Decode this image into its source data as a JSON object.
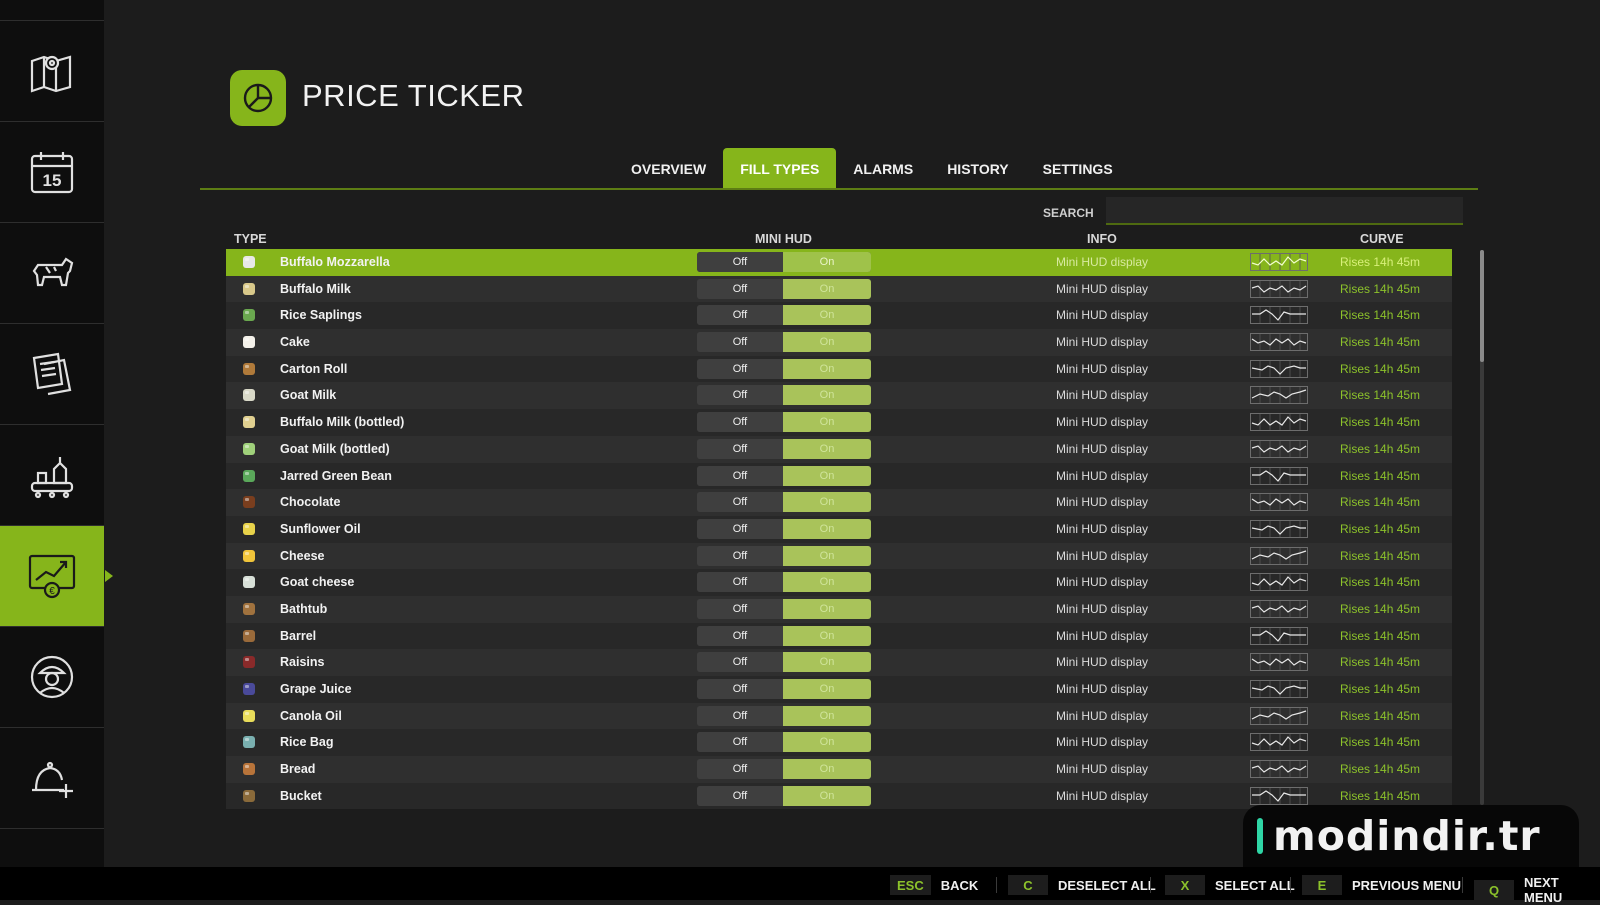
{
  "sidebar": {
    "items": [
      {
        "icon": "map-icon"
      },
      {
        "icon": "calendar-icon",
        "text": "15"
      },
      {
        "icon": "cow-icon"
      },
      {
        "icon": "documents-icon"
      },
      {
        "icon": "production-icon"
      },
      {
        "icon": "price-chart-icon",
        "active": true
      },
      {
        "icon": "worker-icon"
      },
      {
        "icon": "cloche-plus-icon"
      }
    ]
  },
  "header": {
    "title": "PRICE TICKER",
    "icon": "pie-chart-icon"
  },
  "tabs": [
    {
      "label": "OVERVIEW"
    },
    {
      "label": "FILL TYPES",
      "active": true
    },
    {
      "label": "ALARMS"
    },
    {
      "label": "HISTORY"
    },
    {
      "label": "SETTINGS"
    }
  ],
  "search": {
    "label": "SEARCH",
    "value": ""
  },
  "columns": {
    "type": "TYPE",
    "minihud": "MINI HUD",
    "info": "INFO",
    "curve": "CURVE"
  },
  "rows": [
    {
      "name": "Buffalo Mozzarella",
      "off": "Off",
      "on": "On",
      "info": "Mini HUD display",
      "trend": "Rises 14h 45m",
      "selected": true,
      "icon_color": "#e8e8e8"
    },
    {
      "name": "Buffalo Milk",
      "off": "Off",
      "on": "On",
      "info": "Mini HUD display",
      "trend": "Rises 14h 45m",
      "icon_color": "#d8c88a"
    },
    {
      "name": "Rice Saplings",
      "off": "Off",
      "on": "On",
      "info": "Mini HUD display",
      "trend": "Rises 14h 45m",
      "icon_color": "#6aa84f"
    },
    {
      "name": "Cake",
      "off": "Off",
      "on": "On",
      "info": "Mini HUD display",
      "trend": "Rises 14h 45m",
      "icon_color": "#f4f1ea"
    },
    {
      "name": "Carton Roll",
      "off": "Off",
      "on": "On",
      "info": "Mini HUD display",
      "trend": "Rises 14h 45m",
      "icon_color": "#b07a3a"
    },
    {
      "name": "Goat Milk",
      "off": "Off",
      "on": "On",
      "info": "Mini HUD display",
      "trend": "Rises 14h 45m",
      "icon_color": "#d9d9c8"
    },
    {
      "name": "Buffalo Milk (bottled)",
      "off": "Off",
      "on": "On",
      "info": "Mini HUD display",
      "trend": "Rises 14h 45m",
      "icon_color": "#e0d090"
    },
    {
      "name": "Goat Milk (bottled)",
      "off": "Off",
      "on": "On",
      "info": "Mini HUD display",
      "trend": "Rises 14h 45m",
      "icon_color": "#9fd07a"
    },
    {
      "name": "Jarred Green Bean",
      "off": "Off",
      "on": "On",
      "info": "Mini HUD display",
      "trend": "Rises 14h 45m",
      "icon_color": "#5aa85a"
    },
    {
      "name": "Chocolate",
      "off": "Off",
      "on": "On",
      "info": "Mini HUD display",
      "trend": "Rises 14h 45m",
      "icon_color": "#7a3e1e"
    },
    {
      "name": "Sunflower Oil",
      "off": "Off",
      "on": "On",
      "info": "Mini HUD display",
      "trend": "Rises 14h 45m",
      "icon_color": "#e8d24a"
    },
    {
      "name": "Cheese",
      "off": "Off",
      "on": "On",
      "info": "Mini HUD display",
      "trend": "Rises 14h 45m",
      "icon_color": "#f0c43a"
    },
    {
      "name": "Goat cheese",
      "off": "Off",
      "on": "On",
      "info": "Mini HUD display",
      "trend": "Rises 14h 45m",
      "icon_color": "#d8e0d8"
    },
    {
      "name": "Bathtub",
      "off": "Off",
      "on": "On",
      "info": "Mini HUD display",
      "trend": "Rises 14h 45m",
      "icon_color": "#a0723e"
    },
    {
      "name": "Barrel",
      "off": "Off",
      "on": "On",
      "info": "Mini HUD display",
      "trend": "Rises 14h 45m",
      "icon_color": "#9a6a3a"
    },
    {
      "name": "Raisins",
      "off": "Off",
      "on": "On",
      "info": "Mini HUD display",
      "trend": "Rises 14h 45m",
      "icon_color": "#8a2a2a"
    },
    {
      "name": "Grape Juice",
      "off": "Off",
      "on": "On",
      "info": "Mini HUD display",
      "trend": "Rises 14h 45m",
      "icon_color": "#4a4a9a"
    },
    {
      "name": "Canola Oil",
      "off": "Off",
      "on": "On",
      "info": "Mini HUD display",
      "trend": "Rises 14h 45m",
      "icon_color": "#e8dc5a"
    },
    {
      "name": "Rice Bag",
      "off": "Off",
      "on": "On",
      "info": "Mini HUD display",
      "trend": "Rises 14h 45m",
      "icon_color": "#7ab0b0"
    },
    {
      "name": "Bread",
      "off": "Off",
      "on": "On",
      "info": "Mini HUD display",
      "trend": "Rises 14h 45m",
      "icon_color": "#b8743a"
    },
    {
      "name": "Bucket",
      "off": "Off",
      "on": "On",
      "info": "Mini HUD display",
      "trend": "Rises 14h 45m",
      "icon_color": "#8a6a3a"
    }
  ],
  "footer": {
    "hints": [
      {
        "key": "ESC",
        "label": "BACK"
      },
      {
        "key": "C",
        "label": "DESELECT ALL"
      },
      {
        "key": "X",
        "label": "SELECT ALL"
      },
      {
        "key": "E",
        "label": "PREVIOUS MENU"
      },
      {
        "key": "Q",
        "label": "NEXT MENU"
      }
    ]
  },
  "watermark": {
    "text": "modindir.tr"
  },
  "colors": {
    "accent": "#86b51b",
    "trend": "#8cc22b",
    "background": "#1c1c1c",
    "sidebar": "#0e0e0e"
  }
}
